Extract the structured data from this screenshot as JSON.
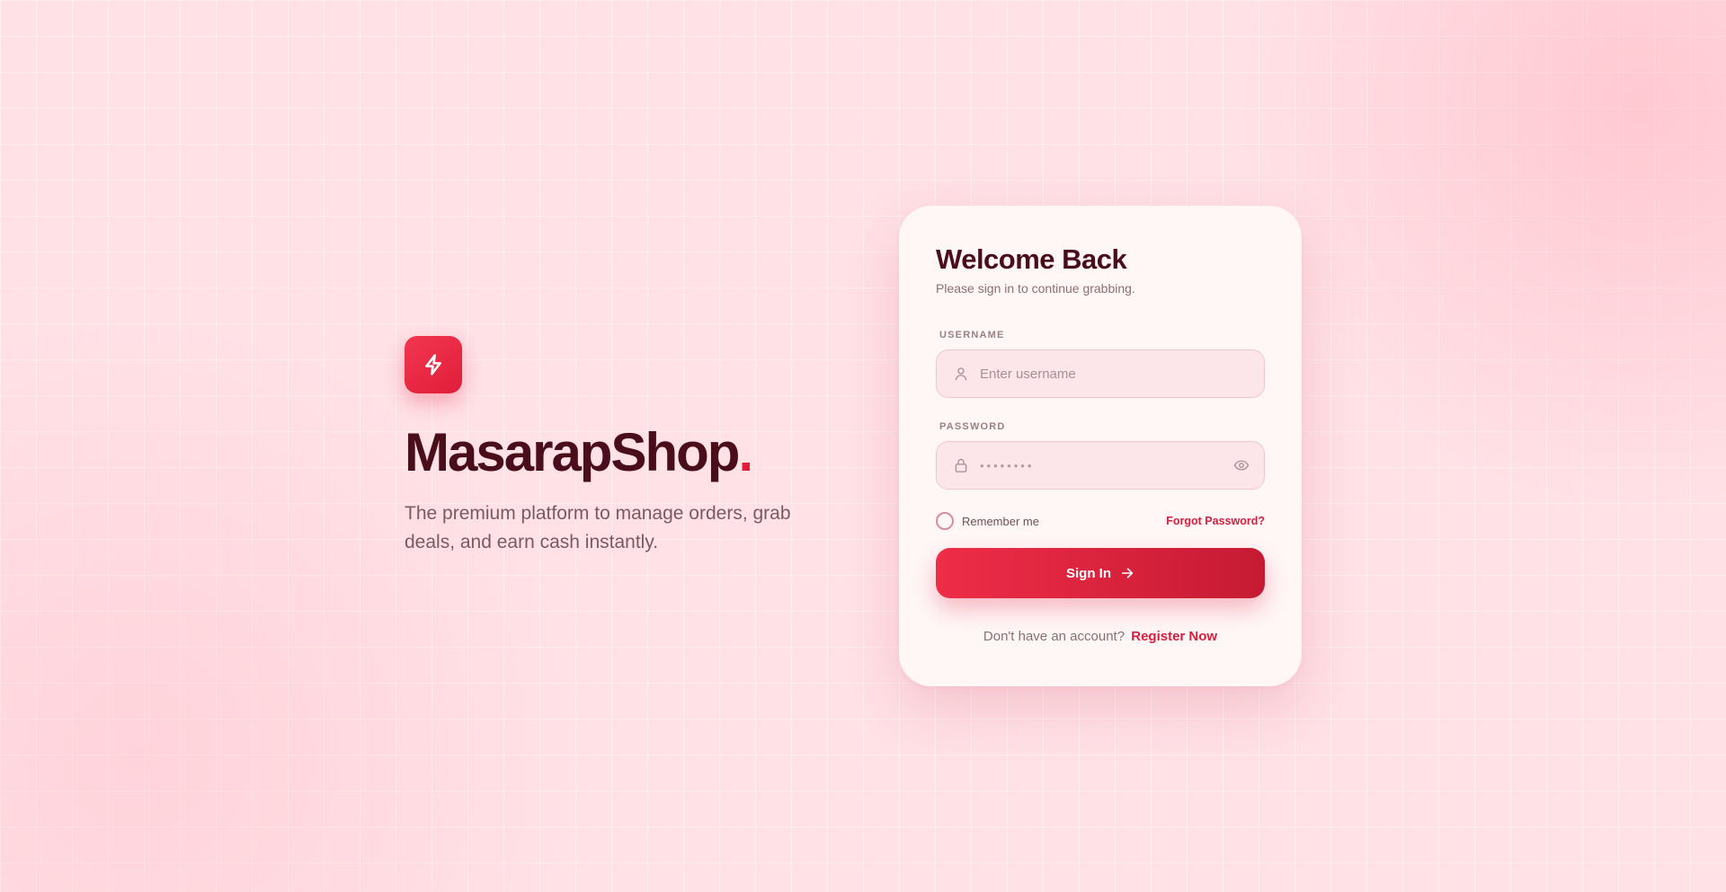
{
  "brand": {
    "name": "MasarapShop",
    "dot": ".",
    "tagline": "The premium platform to manage orders, grab deals, and earn cash instantly.",
    "logo_icon": "lightning-bolt-icon"
  },
  "card": {
    "title": "Welcome Back",
    "subtitle": "Please sign in to continue grabbing."
  },
  "form": {
    "username": {
      "label": "USERNAME",
      "placeholder": "Enter username",
      "value": "",
      "icon": "user-icon"
    },
    "password": {
      "label": "PASSWORD",
      "placeholder": "••••••••",
      "value": "",
      "icon": "lock-icon",
      "toggle_icon": "eye-icon"
    },
    "remember_label": "Remember me",
    "remember_checked": false,
    "forgot_label": "Forgot Password?",
    "submit_label": "Sign In",
    "submit_icon": "arrow-right-icon"
  },
  "footer": {
    "prompt": "Don't have an account?",
    "register_label": "Register Now"
  },
  "colors": {
    "accent": "#e11d3a",
    "heading": "#4a0d1a",
    "background": "#ffe1e6",
    "card": "#fff6f6"
  }
}
